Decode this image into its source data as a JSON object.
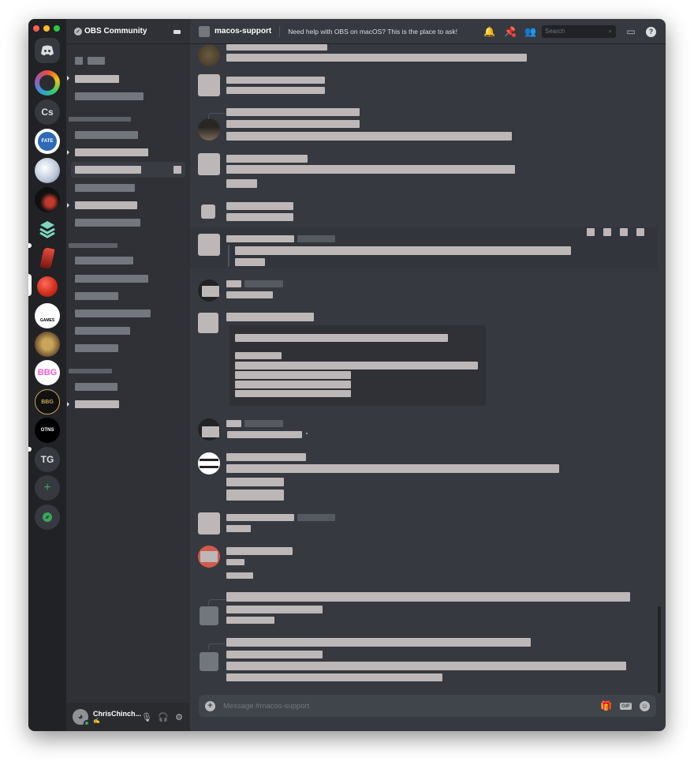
{
  "server": {
    "name": "OBS Community"
  },
  "channel": {
    "name": "macos-support",
    "topic": "Need help with OBS on macOS? This is the place to ask!"
  },
  "search": {
    "placeholder": "Search"
  },
  "composer": {
    "placeholder": "Message #macos-support"
  },
  "user": {
    "name": "ChrisChinch..."
  },
  "guilds": [
    {
      "label": "",
      "icon": "discord-home-icon"
    },
    {
      "label": "",
      "icon": "guild-icon"
    },
    {
      "label": "Cs",
      "icon": ""
    },
    {
      "label": "FATE",
      "icon": "guild-icon"
    },
    {
      "label": "",
      "icon": "guild-icon"
    },
    {
      "label": "",
      "icon": "guild-icon"
    },
    {
      "label": "",
      "icon": "guild-icon"
    },
    {
      "label": "",
      "icon": "guild-icon"
    },
    {
      "label": "",
      "icon": "guild-icon"
    },
    {
      "label": "GAMES",
      "icon": "guild-icon"
    },
    {
      "label": "",
      "icon": "guild-icon"
    },
    {
      "label": "BBG",
      "icon": ""
    },
    {
      "label": "BBG",
      "icon": "guild-icon"
    },
    {
      "label": "OTNS",
      "icon": "guild-icon"
    },
    {
      "label": "TG",
      "icon": ""
    },
    {
      "label": "+",
      "icon": "add-server-icon"
    },
    {
      "label": "",
      "icon": "explore-icon"
    }
  ],
  "colors": {
    "rail": "#202225",
    "sidebar": "#2f3136",
    "chat": "#36393f",
    "redacted": "#bdb7b7",
    "online": "#3ba55d"
  }
}
